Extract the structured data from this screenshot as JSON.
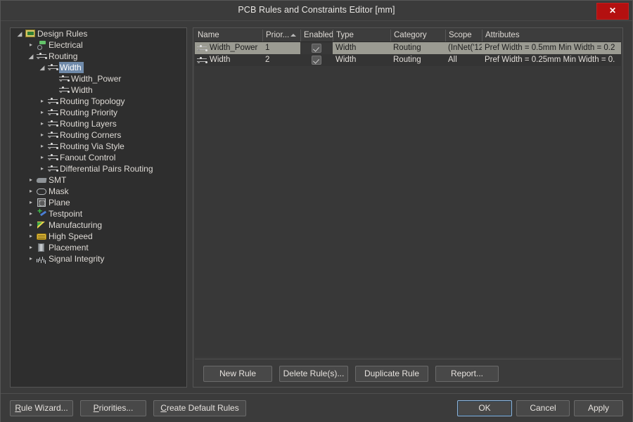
{
  "window": {
    "title": "PCB Rules and Constraints Editor [mm]",
    "close_label": "✕"
  },
  "tree": {
    "items": [
      {
        "label": "Design Rules",
        "icon": "rules-folder-icon",
        "depth": 0,
        "twisty": "expanded",
        "selected": false
      },
      {
        "label": "Electrical",
        "icon": "electrical-icon",
        "depth": 1,
        "twisty": "collapsed",
        "selected": false
      },
      {
        "label": "Routing",
        "icon": "routing-icon",
        "depth": 1,
        "twisty": "expanded",
        "selected": false
      },
      {
        "label": "Width",
        "icon": "routing-icon",
        "depth": 2,
        "twisty": "expanded",
        "selected": true
      },
      {
        "label": "Width_Power",
        "icon": "routing-icon",
        "depth": 3,
        "twisty": "none",
        "selected": false
      },
      {
        "label": "Width",
        "icon": "routing-icon",
        "depth": 3,
        "twisty": "none",
        "selected": false
      },
      {
        "label": "Routing Topology",
        "icon": "routing-icon",
        "depth": 2,
        "twisty": "collapsed",
        "selected": false
      },
      {
        "label": "Routing Priority",
        "icon": "routing-icon",
        "depth": 2,
        "twisty": "collapsed",
        "selected": false
      },
      {
        "label": "Routing Layers",
        "icon": "routing-icon",
        "depth": 2,
        "twisty": "collapsed",
        "selected": false
      },
      {
        "label": "Routing Corners",
        "icon": "routing-icon",
        "depth": 2,
        "twisty": "collapsed",
        "selected": false
      },
      {
        "label": "Routing Via Style",
        "icon": "routing-icon",
        "depth": 2,
        "twisty": "collapsed",
        "selected": false
      },
      {
        "label": "Fanout Control",
        "icon": "routing-icon",
        "depth": 2,
        "twisty": "collapsed",
        "selected": false
      },
      {
        "label": "Differential Pairs Routing",
        "icon": "routing-icon",
        "depth": 2,
        "twisty": "collapsed",
        "selected": false
      },
      {
        "label": "SMT",
        "icon": "smt-icon",
        "depth": 1,
        "twisty": "collapsed",
        "selected": false
      },
      {
        "label": "Mask",
        "icon": "mask-icon",
        "depth": 1,
        "twisty": "collapsed",
        "selected": false
      },
      {
        "label": "Plane",
        "icon": "plane-icon",
        "depth": 1,
        "twisty": "collapsed",
        "selected": false
      },
      {
        "label": "Testpoint",
        "icon": "testpoint-icon",
        "depth": 1,
        "twisty": "collapsed",
        "selected": false
      },
      {
        "label": "Manufacturing",
        "icon": "manufacturing-icon",
        "depth": 1,
        "twisty": "collapsed",
        "selected": false
      },
      {
        "label": "High Speed",
        "icon": "high-speed-icon",
        "depth": 1,
        "twisty": "collapsed",
        "selected": false
      },
      {
        "label": "Placement",
        "icon": "placement-icon",
        "depth": 1,
        "twisty": "collapsed",
        "selected": false
      },
      {
        "label": "Signal Integrity",
        "icon": "signal-integrity-icon",
        "depth": 1,
        "twisty": "collapsed",
        "selected": false
      }
    ]
  },
  "grid": {
    "columns": [
      {
        "label": "Name",
        "sorted": false
      },
      {
        "label": "Prior...",
        "sorted": true
      },
      {
        "label": "Enabled",
        "sorted": false
      },
      {
        "label": "Type",
        "sorted": false
      },
      {
        "label": "Category",
        "sorted": false
      },
      {
        "label": "Scope",
        "sorted": false
      },
      {
        "label": "Attributes",
        "sorted": false
      }
    ],
    "rows": [
      {
        "name": "Width_Power",
        "priority": "1",
        "enabled": true,
        "type": "Width",
        "category": "Routing",
        "scope": "(InNet('12'",
        "attributes": "Pref Width = 0.5mm    Min Width = 0.2",
        "selected": true
      },
      {
        "name": "Width",
        "priority": "2",
        "enabled": true,
        "type": "Width",
        "category": "Routing",
        "scope": "All",
        "attributes": "Pref Width = 0.25mm    Min Width = 0.",
        "selected": false
      }
    ]
  },
  "grid_buttons": {
    "new_rule": "New Rule",
    "delete_rules": "Delete Rule(s)...",
    "duplicate_rule": "Duplicate Rule",
    "report": "Report..."
  },
  "footer": {
    "rule_wizard": "Rule Wizard...",
    "rule_wizard_accel": "R",
    "priorities": "Priorities...",
    "priorities_accel": "P",
    "create_default_rules": "Create Default Rules",
    "create_default_rules_accel": "C",
    "ok": "OK",
    "cancel": "Cancel",
    "apply": "Apply"
  },
  "colors": {
    "window_bg": "#3b3b3b",
    "panel_bg": "#2e2e2e",
    "selection_blue": "#6f8aaa",
    "row_selection": "#a9a9a0",
    "close_red": "#b41010",
    "focus_blue": "#8fb4d9"
  }
}
